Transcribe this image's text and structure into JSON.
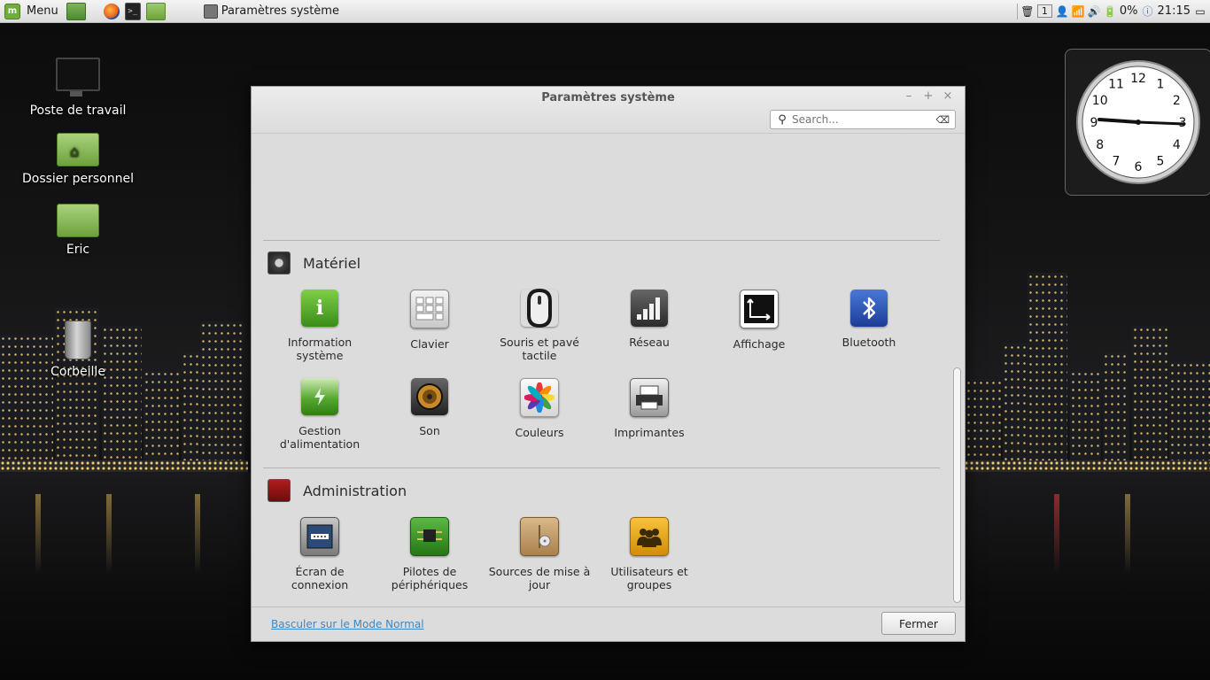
{
  "panel": {
    "menu_label": "Menu",
    "task_title": "Paramètres système",
    "workspace": "1",
    "battery": "0%",
    "clock": "21:15"
  },
  "desktop": {
    "icons": [
      {
        "label": "Poste de travail"
      },
      {
        "label": "Dossier personnel"
      },
      {
        "label": "Eric"
      },
      {
        "label": "Corbeille"
      }
    ]
  },
  "window": {
    "title": "Paramètres système",
    "search_placeholder": "Search...",
    "categories": [
      {
        "title": "Matériel",
        "items": [
          {
            "label": "Information système",
            "icon": "info-icon"
          },
          {
            "label": "Clavier",
            "icon": "keyboard-icon"
          },
          {
            "label": "Souris et pavé tactile",
            "icon": "mouse-icon"
          },
          {
            "label": "Réseau",
            "icon": "network-icon"
          },
          {
            "label": "Affichage",
            "icon": "display-icon"
          },
          {
            "label": "Bluetooth",
            "icon": "bluetooth-icon"
          },
          {
            "label": "Gestion d'alimentation",
            "icon": "battery-icon"
          },
          {
            "label": "Son",
            "icon": "speaker-icon"
          },
          {
            "label": "Couleurs",
            "icon": "color-wheel-icon"
          },
          {
            "label": "Imprimantes",
            "icon": "printer-icon"
          }
        ]
      },
      {
        "title": "Administration",
        "items": [
          {
            "label": "Écran de connexion",
            "icon": "login-screen-icon"
          },
          {
            "label": "Pilotes de périphériques",
            "icon": "chip-icon"
          },
          {
            "label": "Sources de mise à jour",
            "icon": "package-icon"
          },
          {
            "label": "Utilisateurs et groupes",
            "icon": "users-icon"
          }
        ]
      }
    ],
    "footer": {
      "mode_link": "Basculer sur le Mode Normal",
      "close_label": "Fermer"
    }
  },
  "clock_desklet": {
    "time": "21:15",
    "numerals": [
      "12",
      "1",
      "2",
      "3",
      "4",
      "5",
      "6",
      "7",
      "8",
      "9",
      "10",
      "11"
    ]
  }
}
